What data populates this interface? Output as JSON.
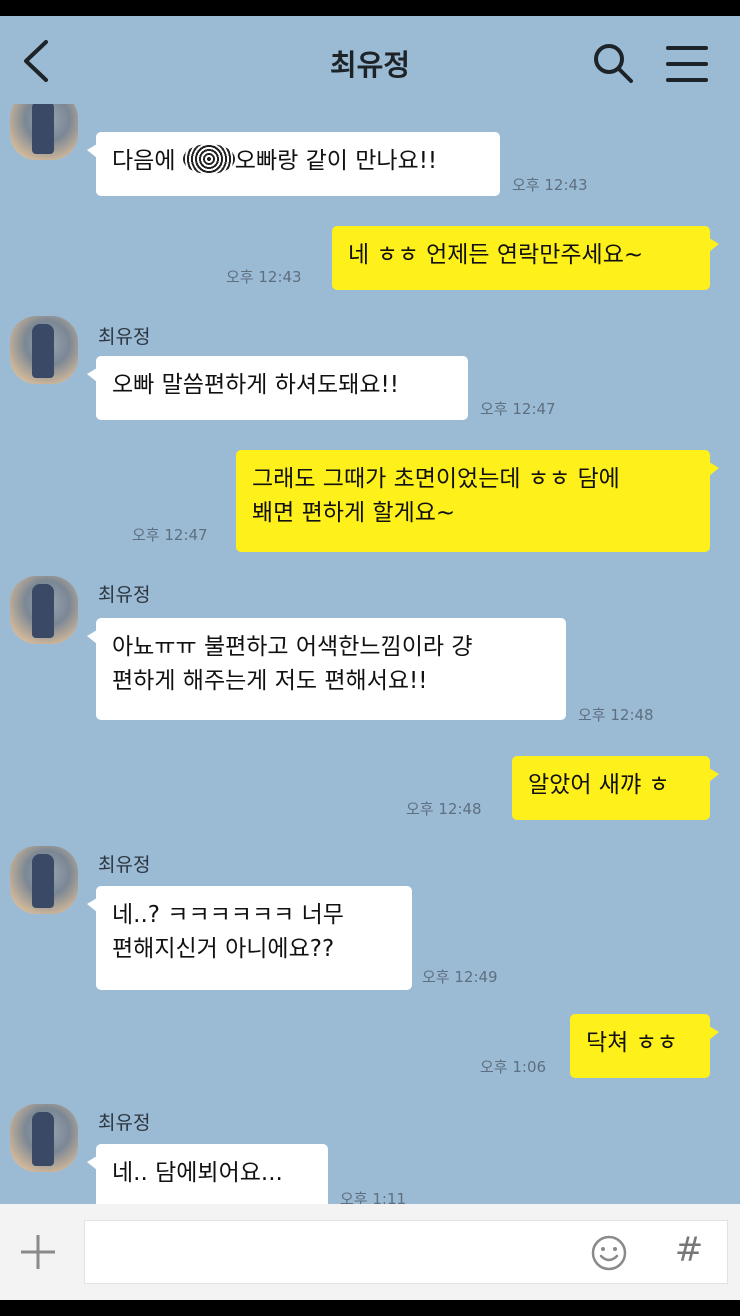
{
  "header": {
    "title": "최유정"
  },
  "input": {
    "placeholder": "",
    "hash_label": "#"
  },
  "messages": [
    {
      "text": "다음에 ",
      "text_after": "오빠랑 같이 만나요!!",
      "time": "오후 12:43"
    },
    {
      "text": "네 ㅎㅎ 언제든 연락만주세요~",
      "time": "오후 12:43"
    },
    {
      "sender": "최유정",
      "text": "오빠 말씀편하게 하셔도돼요!!",
      "time": "오후 12:47"
    },
    {
      "line1": "그래도 그때가 초면이었는데 ㅎㅎ 담에",
      "line2": "봬면 편하게 할게요~",
      "time": "오후 12:47"
    },
    {
      "sender": "최유정",
      "line1": "아뇨ㅠㅠ 불편하고 어색한느낌이라 걍",
      "line2": "편하게 해주는게 저도 편해서요!!",
      "time": "오후 12:48"
    },
    {
      "text": "알았어 새꺄 ㅎ",
      "time": "오후 12:48"
    },
    {
      "sender": "최유정",
      "line1": "네..? ㅋㅋㅋㅋㅋㅋ 너무",
      "line2": "편해지신거 아니에요??",
      "time": "오후 12:49"
    },
    {
      "text": "닥쳐 ㅎㅎ",
      "time": "오후 1:06"
    },
    {
      "sender": "최유정",
      "text": "네.. 담에뵈어요...",
      "time": "오후 1:11"
    }
  ]
}
